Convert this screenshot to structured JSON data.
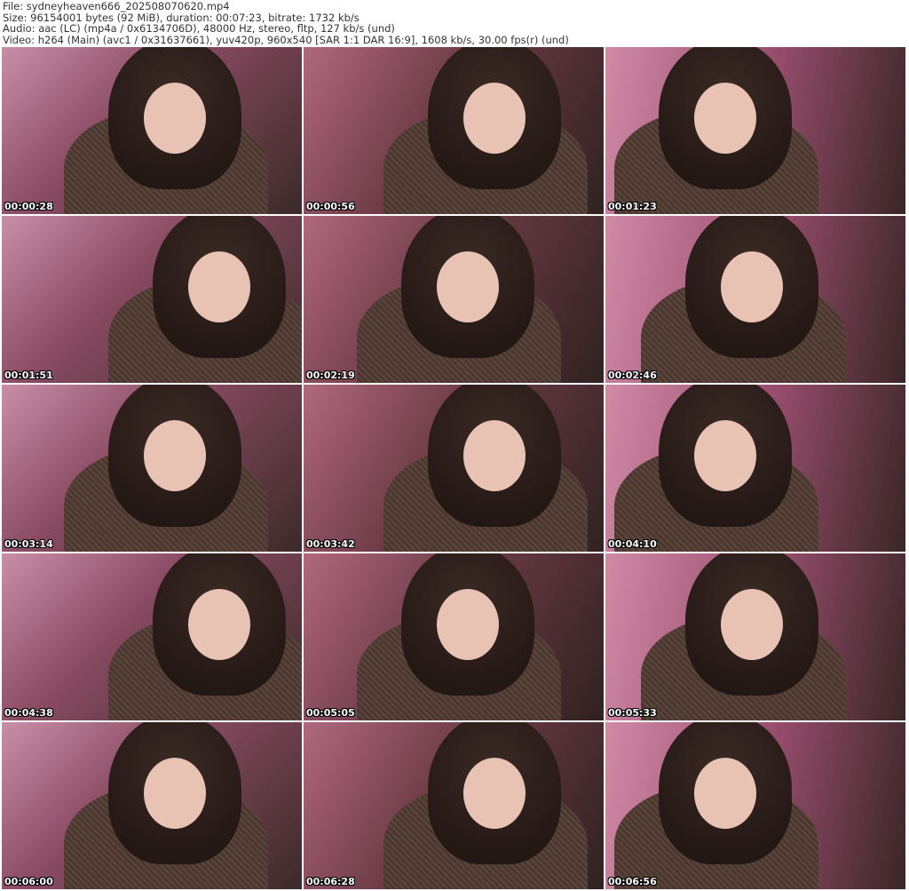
{
  "header": {
    "file": "File: sydneyheaven666_202508070620.mp4",
    "size": "Size: 96154001 bytes (92 MiB), duration: 00:07:23, bitrate: 1732 kb/s",
    "audio": "Audio: aac (LC) (mp4a / 0x6134706D), 48000 Hz, stereo, fltp, 127 kb/s (und)",
    "video": "Video: h264 (Main) (avc1 / 0x31637661), yuv420p, 960x540 [SAR 1:1 DAR 16:9], 1608 kb/s, 30.00 fps(r) (und)"
  },
  "thumbnails": [
    {
      "time": "00:00:28"
    },
    {
      "time": "00:00:56"
    },
    {
      "time": "00:01:23"
    },
    {
      "time": "00:01:51"
    },
    {
      "time": "00:02:19"
    },
    {
      "time": "00:02:46"
    },
    {
      "time": "00:03:14"
    },
    {
      "time": "00:03:42"
    },
    {
      "time": "00:04:10"
    },
    {
      "time": "00:04:38"
    },
    {
      "time": "00:05:05"
    },
    {
      "time": "00:05:33"
    },
    {
      "time": "00:06:00"
    },
    {
      "time": "00:06:28"
    },
    {
      "time": "00:06:56"
    }
  ]
}
